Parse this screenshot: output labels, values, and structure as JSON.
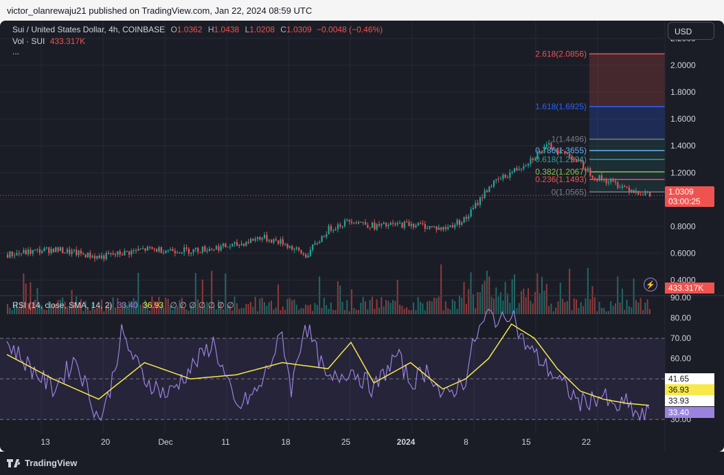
{
  "page": {
    "header_text": "victor_olanrewaju21 published on TradingView.com, Jan 22, 2024 08:59 UTC",
    "footer_brand": "TradingView"
  },
  "legend": {
    "symbol": "Sui / United States Dollar, 4h, COINBASE",
    "o_label": "O",
    "o_value": "1.0362",
    "h_label": "H",
    "h_value": "1.0438",
    "l_label": "L",
    "l_value": "1.0208",
    "c_label": "C",
    "c_value": "1.0309",
    "change": "−0.0048 (−0.46%)",
    "vol_label": "Vol · SUI",
    "vol_value": "433.317K",
    "more": "...",
    "rsi_label": "RSI (14, close, SMA, 14, 2)",
    "rsi_value": "33.40",
    "rsi_sma_value": "36.93",
    "rsi_extra": "∅ ∅ ∅ ∅ ∅ ∅ ∅"
  },
  "toolbar": {
    "currency": "USD"
  },
  "tags": {
    "price": "1.0309",
    "countdown": "03:00:25",
    "volume": "433.317K",
    "rsi_a": "41.65",
    "rsi_b": "36.93",
    "rsi_c": "33.93",
    "rsi_d": "33.40"
  },
  "colors": {
    "up": "#26a69a",
    "down": "#ef5350",
    "rsi": "#9a83e0",
    "rsi_sma": "#f7e94a",
    "background": "#1b1d26"
  },
  "chart_data": [
    {
      "type": "candlestick",
      "title": "Sui / United States Dollar, 4h, COINBASE",
      "y_axis": {
        "ticks": [
          "0.4000",
          "0.6000",
          "0.8000",
          "1.0000",
          "1.2000",
          "1.4000",
          "1.6000",
          "1.8000",
          "2.0000",
          "2.2000"
        ],
        "range": [
          0.3,
          2.2
        ]
      },
      "x_axis": {
        "ticks": [
          "13",
          "20",
          "Dec",
          "11",
          "18",
          "25",
          "2024",
          "8",
          "15",
          "22"
        ]
      },
      "price_path": {
        "x_index": [
          0,
          10,
          20,
          30,
          40,
          50,
          55,
          60,
          65,
          70,
          75,
          80,
          88,
          95,
          100,
          105,
          112,
          118,
          123,
          128,
          134,
          140
        ],
        "close": [
          0.59,
          0.63,
          0.57,
          0.63,
          0.62,
          0.66,
          0.72,
          0.68,
          0.58,
          0.78,
          0.85,
          0.8,
          0.82,
          0.78,
          0.86,
          1.1,
          1.25,
          1.4,
          1.32,
          1.17,
          1.1,
          1.03
        ]
      },
      "fibonacci": [
        {
          "level": "2.618",
          "price": 2.0856
        },
        {
          "level": "1.618",
          "price": 1.6925
        },
        {
          "level": "1",
          "price": 1.4496
        },
        {
          "level": "0.786",
          "price": 1.3655
        },
        {
          "level": "0.618",
          "price": 1.2994
        },
        {
          "level": "0.382",
          "price": 1.2067
        },
        {
          "level": "0.236",
          "price": 1.1493
        },
        {
          "level": "0",
          "price": 1.0565
        }
      ],
      "last_price": 1.0309
    },
    {
      "type": "line",
      "title": "RSI (14, close, SMA, 14, 2)",
      "y_axis": {
        "ticks": [
          "30.00",
          "40.00",
          "50.00",
          "60.00",
          "70.00",
          "80.00",
          "90.00"
        ],
        "range": [
          25,
          90
        ]
      },
      "bands": [
        30,
        50,
        70
      ],
      "series": [
        {
          "name": "RSI",
          "x_index": [
            0,
            5,
            10,
            15,
            20,
            22,
            25,
            30,
            35,
            40,
            45,
            50,
            55,
            60,
            62,
            65,
            70,
            75,
            80,
            85,
            88,
            92,
            95,
            100,
            102,
            105,
            108,
            110,
            112,
            115,
            118,
            120,
            125,
            130,
            132,
            135,
            138,
            140
          ],
          "values": [
            68,
            56,
            45,
            60,
            30,
            40,
            72,
            50,
            42,
            55,
            68,
            35,
            45,
            72,
            45,
            78,
            48,
            55,
            45,
            62,
            48,
            55,
            40,
            50,
            70,
            82,
            78,
            85,
            70,
            62,
            55,
            50,
            38,
            42,
            35,
            38,
            31,
            33
          ]
        },
        {
          "name": "RSI-based MA",
          "x_index": [
            0,
            10,
            20,
            30,
            40,
            50,
            60,
            70,
            75,
            80,
            88,
            95,
            100,
            105,
            110,
            115,
            120,
            125,
            130,
            135,
            140
          ],
          "values": [
            62,
            50,
            40,
            58,
            50,
            52,
            58,
            55,
            68,
            48,
            58,
            45,
            50,
            60,
            77,
            70,
            55,
            44,
            40,
            38,
            36.93
          ]
        }
      ]
    }
  ]
}
